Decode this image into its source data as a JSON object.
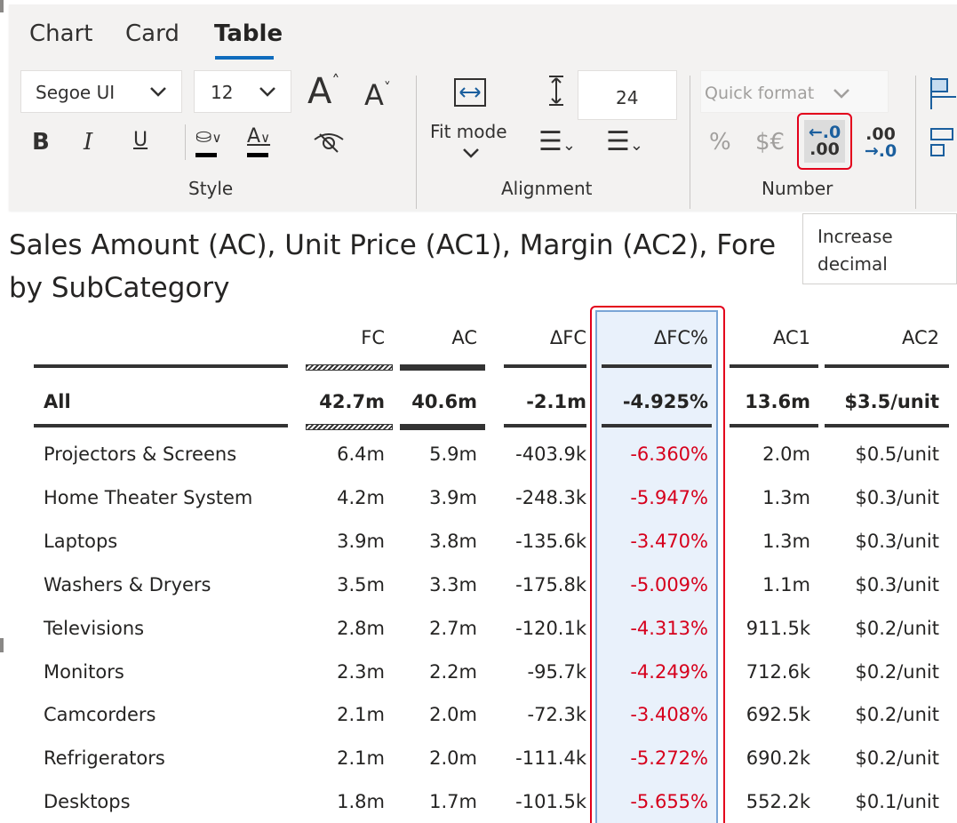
{
  "tabs": [
    {
      "label": "Chart",
      "active": false
    },
    {
      "label": "Card",
      "active": false
    },
    {
      "label": "Table",
      "active": true
    }
  ],
  "style_group": {
    "font_family": "Segoe UI",
    "font_size": "12",
    "bold": "B",
    "italic": "I",
    "underline": "U",
    "group_label": "Style"
  },
  "alignment_group": {
    "fit_mode_label": "Fit mode",
    "row_height": "24",
    "group_label": "Alignment"
  },
  "number_group": {
    "quick_format_placeholder": "Quick format",
    "percent": "%",
    "currency": "$€",
    "increase_decimal_top": "←.0",
    "increase_decimal_bottom": ".00",
    "decrease_decimal_top": ".00",
    "decrease_decimal_bottom": "→.0",
    "group_label": "Number"
  },
  "tooltip": {
    "line1": "Increase",
    "line2": "decimal"
  },
  "chart": {
    "title_line1": "Sales Amount (AC), Unit Price (AC1), Margin (AC2), Fore",
    "title_line2": "by SubCategory"
  },
  "table": {
    "headers": [
      "FC",
      "AC",
      "ΔFC",
      "ΔFC%",
      "AC1",
      "AC2"
    ],
    "total": {
      "name": "All",
      "FC": "42.7m",
      "AC": "40.6m",
      "dFC": "-2.1m",
      "dFCpct": "-4.925%",
      "AC1": "13.6m",
      "AC2": "$3.5/unit"
    },
    "rows": [
      {
        "name": "Projectors & Screens",
        "FC": "6.4m",
        "AC": "5.9m",
        "dFC": "-403.9k",
        "dFCpct": "-6.360%",
        "AC1": "2.0m",
        "AC2": "$0.5/unit"
      },
      {
        "name": "Home Theater System",
        "FC": "4.2m",
        "AC": "3.9m",
        "dFC": "-248.3k",
        "dFCpct": "-5.947%",
        "AC1": "1.3m",
        "AC2": "$0.3/unit"
      },
      {
        "name": "Laptops",
        "FC": "3.9m",
        "AC": "3.8m",
        "dFC": "-135.6k",
        "dFCpct": "-3.470%",
        "AC1": "1.3m",
        "AC2": "$0.3/unit"
      },
      {
        "name": "Washers & Dryers",
        "FC": "3.5m",
        "AC": "3.3m",
        "dFC": "-175.8k",
        "dFCpct": "-5.009%",
        "AC1": "1.1m",
        "AC2": "$0.3/unit"
      },
      {
        "name": "Televisions",
        "FC": "2.8m",
        "AC": "2.7m",
        "dFC": "-120.1k",
        "dFCpct": "-4.313%",
        "AC1": "911.5k",
        "AC2": "$0.2/unit"
      },
      {
        "name": "Monitors",
        "FC": "2.3m",
        "AC": "2.2m",
        "dFC": "-95.7k",
        "dFCpct": "-4.249%",
        "AC1": "712.6k",
        "AC2": "$0.2/unit"
      },
      {
        "name": "Camcorders",
        "FC": "2.1m",
        "AC": "2.0m",
        "dFC": "-72.3k",
        "dFCpct": "-3.408%",
        "AC1": "692.5k",
        "AC2": "$0.2/unit"
      },
      {
        "name": "Refrigerators",
        "FC": "2.1m",
        "AC": "2.0m",
        "dFC": "-111.4k",
        "dFCpct": "-5.272%",
        "AC1": "690.2k",
        "AC2": "$0.2/unit"
      },
      {
        "name": "Desktops",
        "FC": "1.8m",
        "AC": "1.7m",
        "dFC": "-101.5k",
        "dFCpct": "-5.655%",
        "AC1": "552.2k",
        "AC2": "$0.1/unit"
      }
    ]
  },
  "colors": {
    "accent": "#0f6cbd",
    "highlight_border": "#e3001b",
    "negative": "#d6001c",
    "column_fill": "#e9f1fb"
  }
}
